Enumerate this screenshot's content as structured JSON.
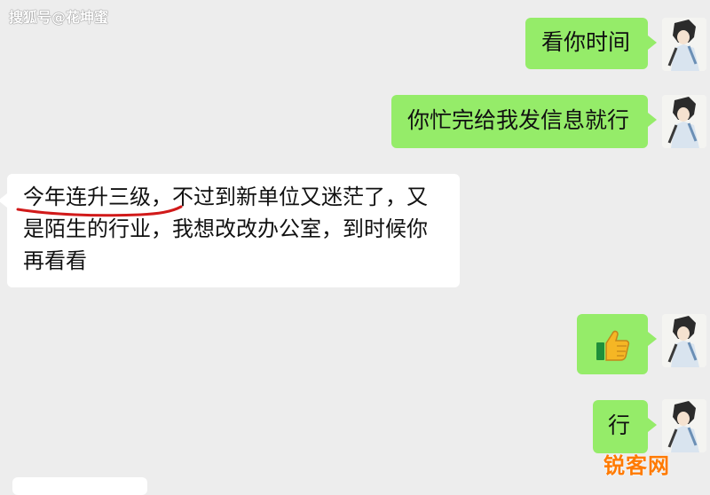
{
  "watermark_top": "搜狐号@花坤蜜",
  "watermark_bottom": "锐客网",
  "messages": [
    {
      "side": "sent",
      "text": "看你时间"
    },
    {
      "side": "sent",
      "text": "你忙完给我发信息就行"
    },
    {
      "side": "received",
      "text_line1": "今年连升三级，不过到新单位又迷茫了，又",
      "text_line2": "是陌生的行业，我想改改办公室，到时候你",
      "text_line3": "再看看"
    },
    {
      "side": "sent",
      "icon": "thumbs-up-icon"
    },
    {
      "side": "sent",
      "text": "行"
    }
  ],
  "colors": {
    "sent_bubble": "#95ec69",
    "received_bubble": "#ffffff",
    "background": "#ededed",
    "underline": "#d11a1a",
    "watermark_bottom": "#ff7a00"
  }
}
